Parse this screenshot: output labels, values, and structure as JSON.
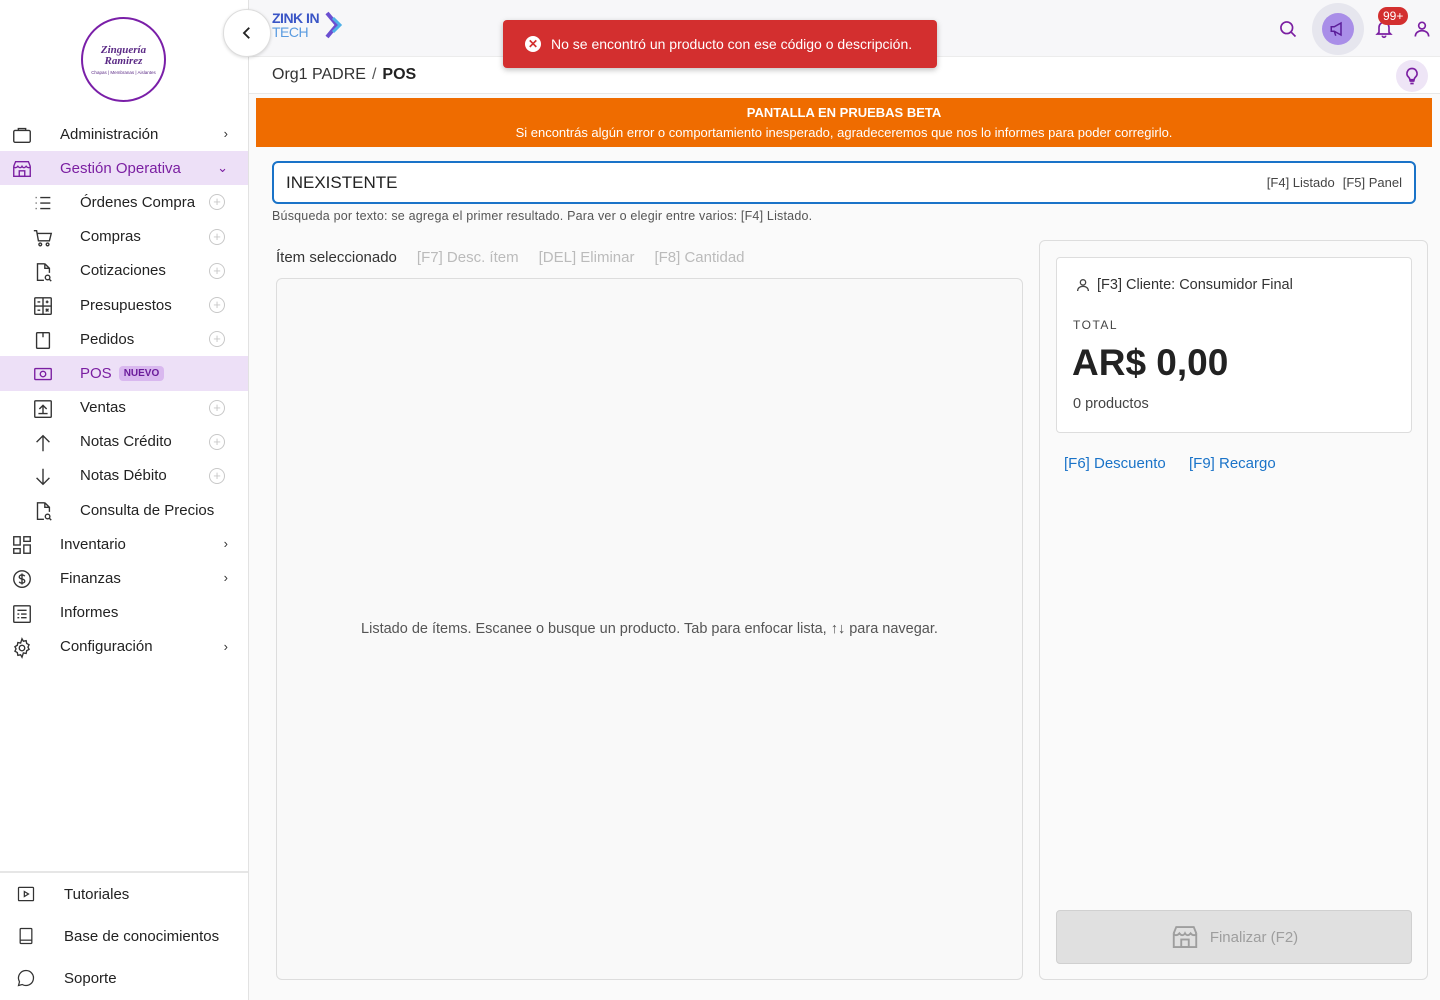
{
  "sidebar": {
    "logo": {
      "title_line1": "Zinguería",
      "title_line2": "Ramirez",
      "subtitle": "Chapas | Membranas | Aislantes"
    },
    "nav": {
      "administracion": "Administración",
      "gestion": "Gestión Operativa",
      "ordenes": "Órdenes Compra",
      "compras": "Compras",
      "cotizaciones": "Cotizaciones",
      "presupuestos": "Presupuestos",
      "pedidos": "Pedidos",
      "pos": "POS",
      "pos_badge": "NUEVO",
      "ventas": "Ventas",
      "notas_credito": "Notas Crédito",
      "notas_debito": "Notas Débito",
      "consulta_precios": "Consulta de Precios",
      "inventario": "Inventario",
      "finanzas": "Finanzas",
      "informes": "Informes",
      "configuracion": "Configuración"
    },
    "bottom": {
      "tutoriales": "Tutoriales",
      "base": "Base de conocimientos",
      "soporte": "Soporte"
    }
  },
  "header": {
    "brand_line1": "ZINK IN",
    "brand_line2": "TECH",
    "notif_count": "99+",
    "breadcrumb": {
      "org": "Org1 PADRE",
      "sep": "/",
      "current": "POS"
    }
  },
  "toast": {
    "message": "No se encontró un producto con ese código o descripción."
  },
  "beta": {
    "title": "PANTALLA EN PRUEBAS BETA",
    "message": "Si encontrás algún error o comportamiento inesperado, agradeceremos que nos lo informes para poder corregirlo."
  },
  "search": {
    "value": "INEXISTENTE",
    "key_listado": "[F4] Listado",
    "key_panel": "[F5] Panel",
    "hint": "Búsqueda por texto: se agrega el primer resultado. Para ver o elegir entre varios: [F4] Listado."
  },
  "tabs": {
    "selected": "Ítem seleccionado",
    "desc": "[F7] Desc. ítem",
    "del": "[DEL] Eliminar",
    "qty": "[F8] Cantidad"
  },
  "items": {
    "empty": "Listado de ítems. Escanee o busque un producto. Tab para enfocar lista, ↑↓ para navegar."
  },
  "summary": {
    "client": "[F3] Cliente: Consumidor Final",
    "total_label": "TOTAL",
    "total_amount": "AR$ 0,00",
    "product_count": "0 productos",
    "discount": "[F6] Descuento",
    "surcharge": "[F9] Recargo",
    "finalize": "Finalizar (F2)"
  },
  "colors": {
    "accent": "#7b1fa2",
    "beta": "#ef6c00",
    "error": "#d32f2f",
    "link": "#1a73c8"
  }
}
